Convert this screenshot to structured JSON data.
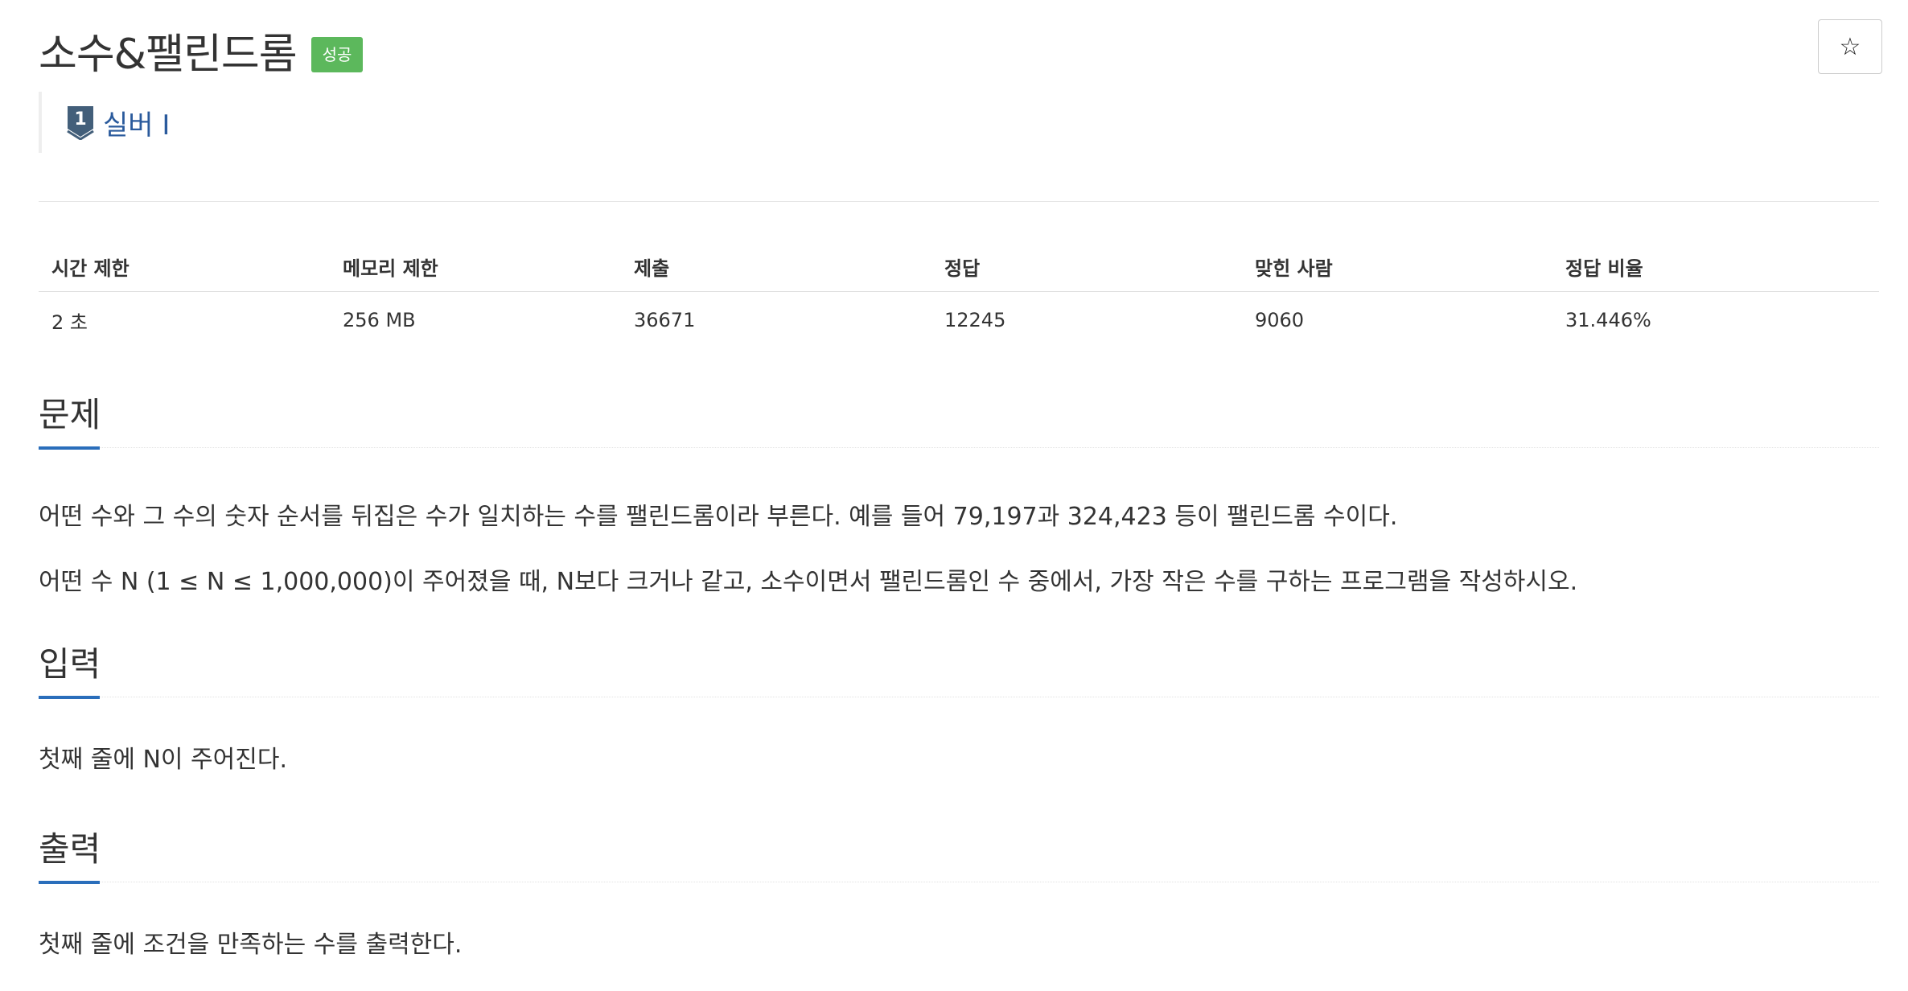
{
  "problem": {
    "title": "소수&팰린드롬",
    "result_badge": "성공",
    "star_icon": "☆",
    "tier": {
      "number": "1",
      "label": "실버 I",
      "color": "#2a5a9c"
    }
  },
  "info_table": {
    "headers": [
      "시간 제한",
      "메모리 제한",
      "제출",
      "정답",
      "맞힌 사람",
      "정답 비율"
    ],
    "values": [
      "2 초",
      "256 MB",
      "36671",
      "12245",
      "9060",
      "31.446%"
    ]
  },
  "sections": {
    "description": {
      "title": "문제",
      "paragraphs": [
        "어떤 수와 그 수의 숫자 순서를 뒤집은 수가 일치하는 수를 팰린드롬이라 부른다. 예를 들어 79,197과 324,423 등이 팰린드롬 수이다.",
        "어떤 수 N (1 ≤ N ≤ 1,000,000)이 주어졌을 때, N보다 크거나 같고, 소수이면서 팰린드롬인 수 중에서, 가장 작은 수를 구하는 프로그램을 작성하시오."
      ]
    },
    "input": {
      "title": "입력",
      "text": "첫째 줄에 N이 주어진다."
    },
    "output": {
      "title": "출력",
      "text": "첫째 줄에 조건을 만족하는 수를 출력한다."
    }
  },
  "colors": {
    "badge_success": "#5cb85c",
    "section_accent": "#2a6ebb"
  }
}
